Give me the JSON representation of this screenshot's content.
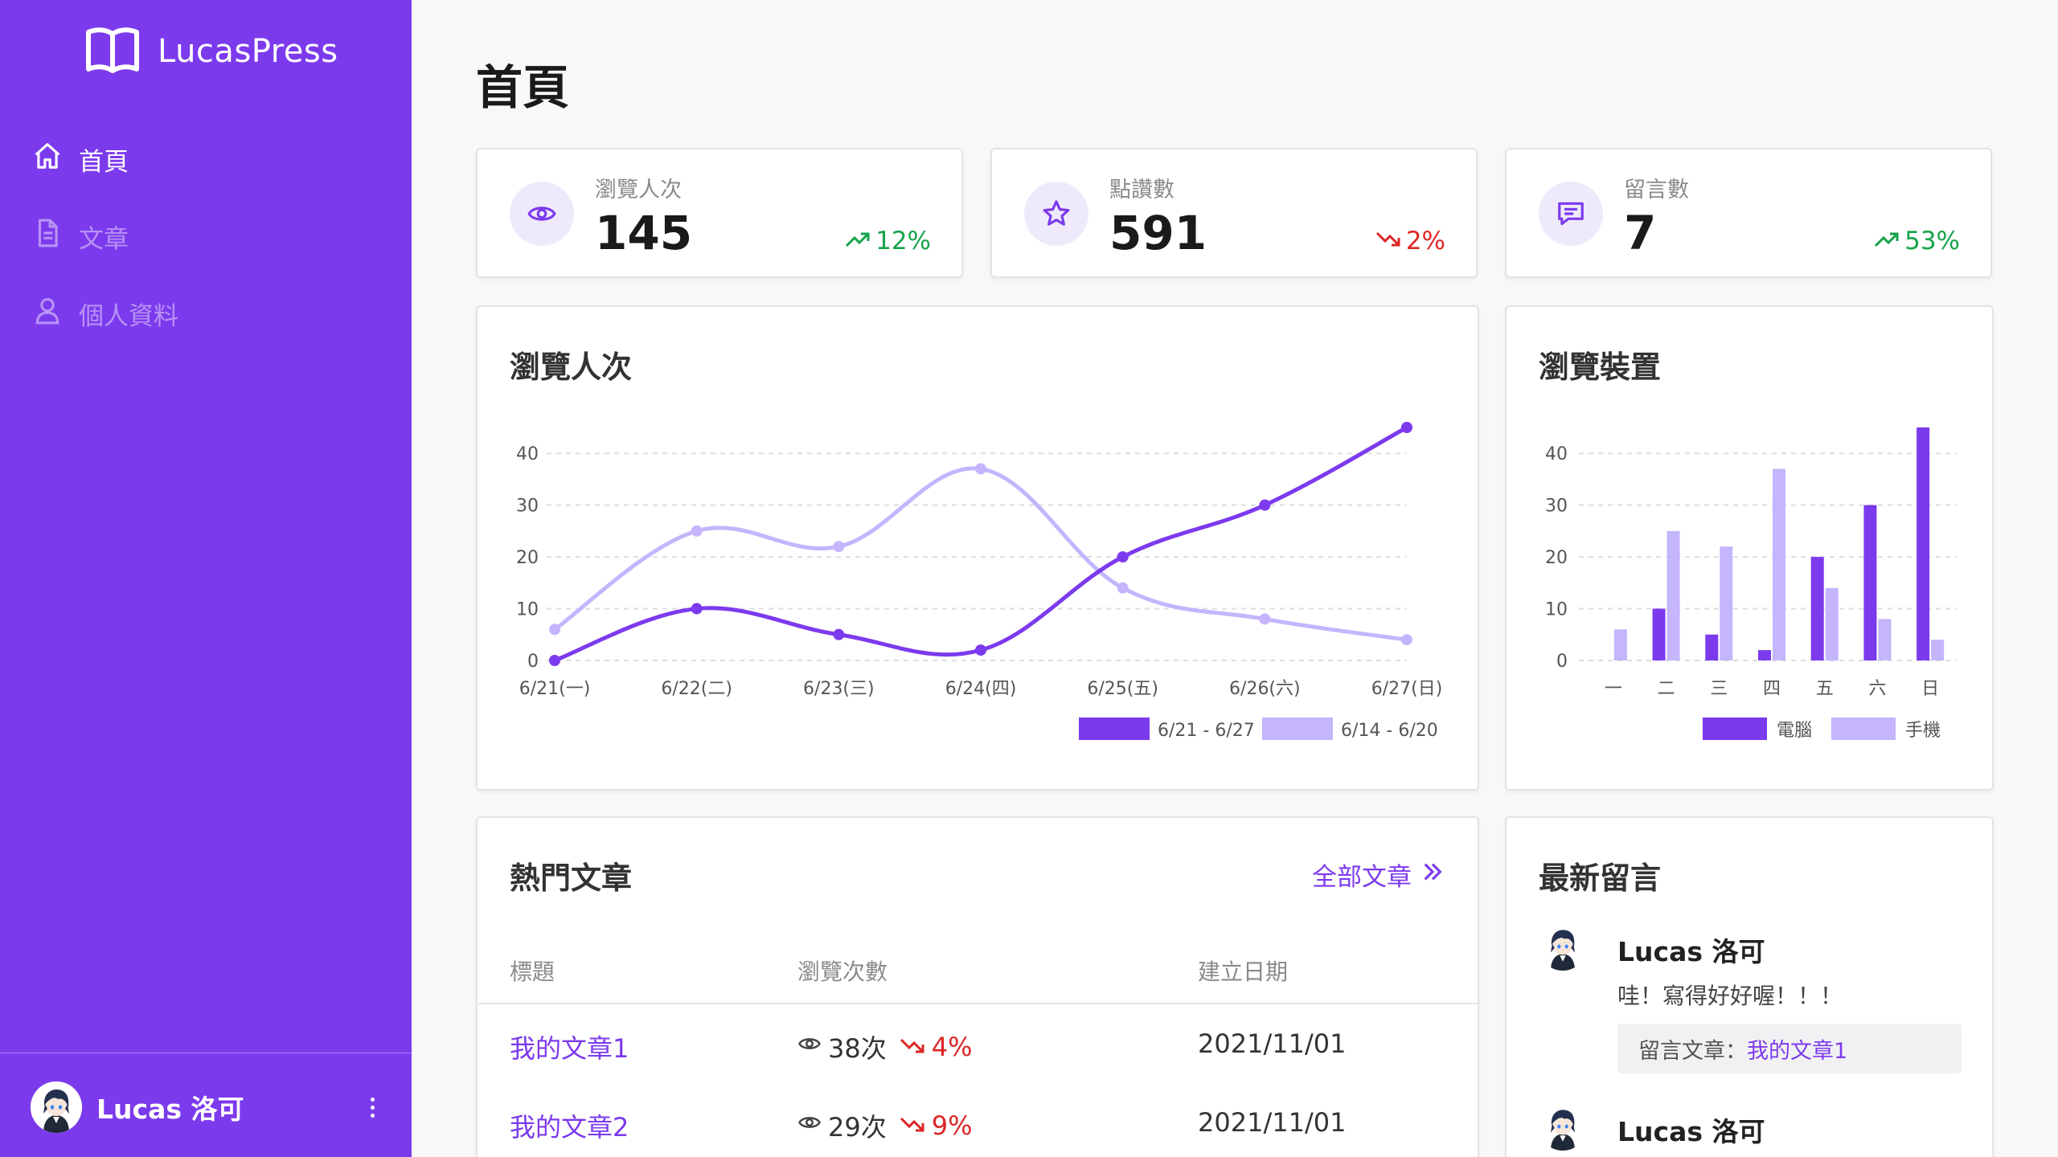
{
  "app": {
    "name": "LucasPress"
  },
  "colors": {
    "primary": "#7c3aed",
    "secondary": "#c4b5fd",
    "up": "#16a34a",
    "down": "#dc2626"
  },
  "nav": [
    {
      "label": "首頁",
      "icon": "home-icon",
      "active": true
    },
    {
      "label": "文章",
      "icon": "document-icon",
      "active": false
    },
    {
      "label": "個人資料",
      "icon": "user-icon",
      "active": false
    }
  ],
  "user": {
    "name": "Lucas 洛可"
  },
  "page": {
    "title": "首頁"
  },
  "stats": [
    {
      "label": "瀏覽人次",
      "value": "145",
      "change": "12%",
      "trend": "up",
      "icon": "eye-icon"
    },
    {
      "label": "點讚數",
      "value": "591",
      "change": "2%",
      "trend": "down",
      "icon": "star-icon"
    },
    {
      "label": "留言數",
      "value": "7",
      "change": "53%",
      "trend": "up",
      "icon": "comment-icon"
    }
  ],
  "chart_data": [
    {
      "type": "line",
      "title": "瀏覽人次",
      "categories": [
        "6/21(一)",
        "6/22(二)",
        "6/23(三)",
        "6/24(四)",
        "6/25(五)",
        "6/26(六)",
        "6/27(日)"
      ],
      "yticks": [
        "0",
        "10",
        "20",
        "30",
        "40"
      ],
      "ylim": [
        0,
        45
      ],
      "series": [
        {
          "name": "6/21 - 6/27",
          "color": "#7c3aed",
          "values": [
            0,
            10,
            5,
            2,
            20,
            30,
            45
          ]
        },
        {
          "name": "6/14 - 6/20",
          "color": "#c4b5fd",
          "values": [
            6,
            25,
            22,
            37,
            14,
            8,
            4
          ]
        }
      ],
      "grid": true,
      "legend": "bottom-right"
    },
    {
      "type": "bar",
      "title": "瀏覽裝置",
      "categories": [
        "一",
        "二",
        "三",
        "四",
        "五",
        "六",
        "日"
      ],
      "yticks": [
        "0",
        "10",
        "20",
        "30",
        "40"
      ],
      "ylim": [
        0,
        45
      ],
      "series": [
        {
          "name": "電腦",
          "color": "#7c3aed",
          "values": [
            0,
            10,
            5,
            2,
            20,
            30,
            45
          ]
        },
        {
          "name": "手機",
          "color": "#c4b5fd",
          "values": [
            6,
            25,
            22,
            37,
            14,
            8,
            4
          ]
        }
      ],
      "grid": true,
      "legend": "bottom"
    }
  ],
  "popular": {
    "title": "熱門文章",
    "link": "全部文章",
    "headers": [
      "標題",
      "瀏覽次數",
      "建立日期"
    ],
    "rows": [
      {
        "title": "我的文章1",
        "views": "38次",
        "change": "4%",
        "trend": "down",
        "date": "2021/11/01"
      },
      {
        "title": "我的文章2",
        "views": "29次",
        "change": "9%",
        "trend": "down",
        "date": "2021/11/01"
      }
    ]
  },
  "comments": {
    "title": "最新留言",
    "items": [
      {
        "name": "Lucas 洛可",
        "text": "哇！寫得好好喔！！！",
        "ref_label": "留言文章：",
        "ref_link": "我的文章1"
      },
      {
        "name": "Lucas 洛可"
      }
    ]
  }
}
